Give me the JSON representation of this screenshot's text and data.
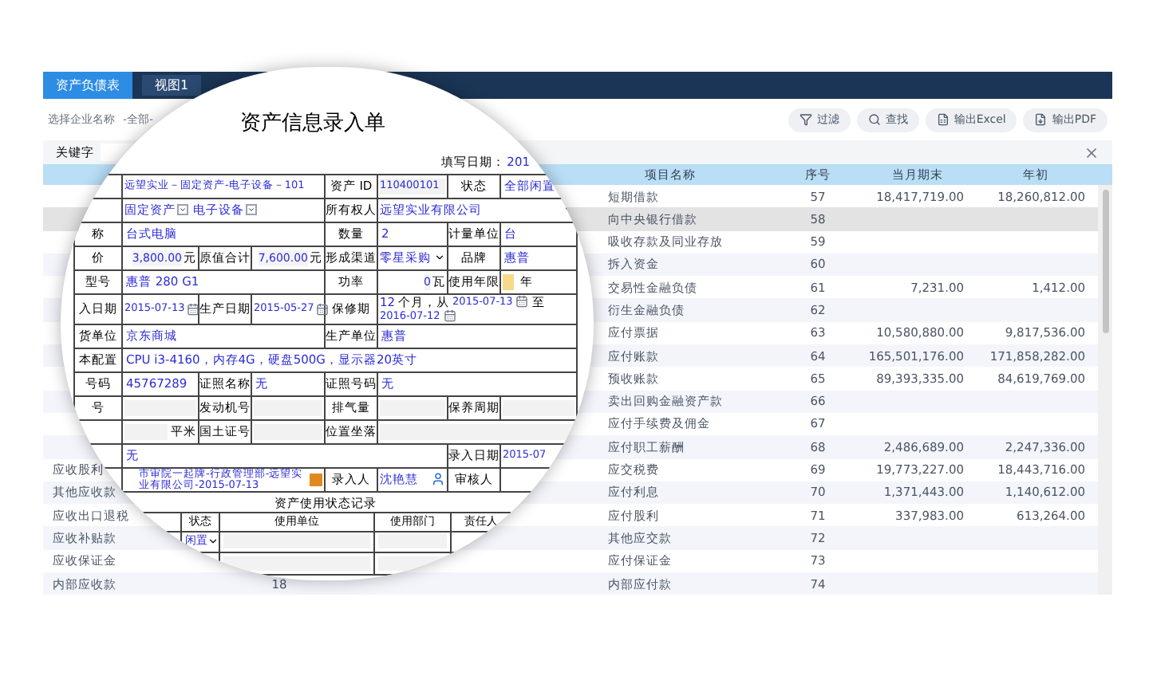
{
  "tabs": [
    {
      "label": "资产负债表",
      "selected": true
    },
    {
      "label": "视图1",
      "selected": false
    }
  ],
  "toolbar": {
    "company_label": "选择企业名称",
    "company_value": "-全部-",
    "buttons": [
      {
        "label": "过滤",
        "kind": "filter"
      },
      {
        "label": "查找",
        "kind": "search"
      },
      {
        "label": "输出Excel",
        "kind": "excel"
      },
      {
        "label": "输出PDF",
        "kind": "pdf"
      }
    ]
  },
  "keyword": {
    "label": "关键字"
  },
  "table": {
    "columns": [
      "项目名称",
      "序号",
      "当月期末",
      "年初"
    ],
    "rows": [
      {
        "name": "短期借款",
        "no": "57",
        "end": "18,417,719.00",
        "start": "18,260,812.00",
        "highlighted": false
      },
      {
        "name": "向中央银行借款",
        "no": "58",
        "highlighted": true
      },
      {
        "name": "吸收存款及同业存放",
        "no": "59",
        "highlighted": false
      },
      {
        "name": "拆入资金",
        "no": "60",
        "highlighted": false
      },
      {
        "name": "交易性金融负债",
        "no": "61",
        "end": "7,231.00",
        "start": "1,412.00",
        "highlighted": false
      },
      {
        "name": "衍生金融负债",
        "no": "62",
        "highlighted": false
      },
      {
        "name": "应付票据",
        "no": "63",
        "end": "10,580,880.00",
        "start": "9,817,536.00",
        "highlighted": false
      },
      {
        "name": "应付账款",
        "no": "64",
        "end": "165,501,176.00",
        "start": "171,858,282.00",
        "highlighted": false
      },
      {
        "name": "预收账款",
        "no": "65",
        "end": "89,393,335.00",
        "start": "84,619,769.00",
        "highlighted": false
      },
      {
        "name": "卖出回购金融资产款",
        "no": "66",
        "highlighted": false
      },
      {
        "name": "应付手续费及佣金",
        "no": "67",
        "highlighted": false
      },
      {
        "name": "应付职工薪酬",
        "no": "68",
        "end": "2,486,689.00",
        "start": "2,247,336.00",
        "highlighted": false
      },
      {
        "name": "应交税费",
        "no": "69",
        "end": "19,773,227.00",
        "start": "18,443,716.00",
        "highlighted": false,
        "left_name": "应收股利"
      },
      {
        "name": "应付利息",
        "no": "70",
        "end": "1,371,443.00",
        "start": "1,140,612.00",
        "highlighted": false,
        "left_name": "其他应收款"
      },
      {
        "name": "应付股利",
        "no": "71",
        "end": "337,983.00",
        "start": "613,264.00",
        "highlighted": false,
        "left_name": "应收出口退税"
      },
      {
        "name": "其他应交款",
        "no": "72",
        "highlighted": false,
        "left_name": "应收补贴款"
      },
      {
        "name": "应付保证金",
        "no": "73",
        "highlighted": false,
        "left_name": "应收保证金"
      },
      {
        "name": "内部应付款",
        "no": "74",
        "highlighted": false,
        "left_name": "内部应收款",
        "left_value": "18"
      }
    ]
  },
  "form": {
    "title": "资产信息录入单",
    "fill_date_label": "填写日期：",
    "fill_date": "201",
    "rows": [
      {
        "cells": [
          {
            "kind": "blank"
          },
          {
            "kind": "small",
            "text": "远望实业－固定资产-电子设备－101"
          },
          "",
          "",
          {
            "kind": "label",
            "text": "资产 ID"
          },
          {
            "kind": "shaded",
            "text": "110400101"
          },
          {
            "kind": "label",
            "text": "状态"
          },
          {
            "kind": "text",
            "text": "全部闲置"
          }
        ]
      },
      {
        "cells": [
          {
            "kind": "blank"
          },
          {
            "kind": "selects",
            "options": [
              "固定资产",
              "电子设备"
            ]
          },
          "",
          "",
          {
            "kind": "label",
            "text": "所有权人"
          },
          {
            "kind": "select",
            "text": "远望实业有限公司"
          },
          "",
          ""
        ]
      },
      {
        "cells": [
          {
            "kind": "label",
            "text": "称"
          },
          {
            "kind": "text",
            "text": "台式电脑"
          },
          "",
          "",
          {
            "kind": "label",
            "text": "数量"
          },
          {
            "kind": "text",
            "text": "2"
          },
          {
            "kind": "label",
            "text": "计量单位"
          },
          {
            "kind": "text",
            "text": "台"
          }
        ]
      },
      {
        "cells": [
          {
            "kind": "label",
            "text": "价"
          },
          {
            "kind": "amount",
            "text": "3,800.00",
            "unit": "元"
          },
          {
            "kind": "label",
            "text": "原值合计"
          },
          {
            "kind": "amount",
            "text": "7,600.00",
            "unit": "元"
          },
          {
            "kind": "label",
            "text": "形成渠道"
          },
          {
            "kind": "select",
            "text": "零星采购"
          },
          {
            "kind": "label",
            "text": "品牌"
          },
          {
            "kind": "text",
            "text": "惠普"
          }
        ]
      },
      {
        "cells": [
          {
            "kind": "label",
            "text": "型号"
          },
          {
            "kind": "text",
            "text": "惠普 280 G1"
          },
          "",
          "",
          {
            "kind": "label",
            "text": "功率"
          },
          {
            "kind": "amount",
            "text": "0",
            "unit": "瓦"
          },
          {
            "kind": "label",
            "text": "使用年限"
          },
          {
            "kind": "years",
            "unit": "年"
          }
        ]
      },
      {
        "cells": [
          {
            "kind": "label",
            "text": "入日期"
          },
          {
            "kind": "date",
            "text": "2015-07-13"
          },
          {
            "kind": "label",
            "text": "生产日期"
          },
          {
            "kind": "date",
            "text": "2015-05-27"
          },
          {
            "kind": "label",
            "text": "保修期"
          },
          {
            "kind": "warranty",
            "months": "12",
            "from_label": "个月，从",
            "from": "2015-07-13",
            "to_label": "至",
            "to": "2016-07-12"
          },
          "",
          ""
        ]
      },
      {
        "cells": [
          {
            "kind": "label",
            "text": "货单位"
          },
          {
            "kind": "text",
            "text": "京东商城"
          },
          "",
          "",
          {
            "kind": "label",
            "text": "生产单位"
          },
          {
            "kind": "text",
            "text": "惠普"
          },
          "",
          ""
        ]
      },
      {
        "cells": [
          {
            "kind": "label",
            "text": "本配置"
          },
          {
            "kind": "text",
            "text": "CPU i3-4160，内存4G，硬盘500G，显示器20英寸"
          },
          "",
          "",
          "",
          "",
          "",
          ""
        ]
      },
      {
        "cells": [
          {
            "kind": "label",
            "text": "号码"
          },
          {
            "kind": "text",
            "text": "45767289"
          },
          {
            "kind": "label",
            "text": "证照名称"
          },
          {
            "kind": "text",
            "text": "无"
          },
          {
            "kind": "label",
            "text": "证照号码"
          },
          {
            "kind": "text",
            "text": "无"
          },
          "",
          ""
        ]
      },
      {
        "cells": [
          {
            "kind": "label",
            "text": "号"
          },
          {
            "kind": "field"
          },
          {
            "kind": "label",
            "text": "发动机号"
          },
          {
            "kind": "field"
          },
          {
            "kind": "label",
            "text": "排气量"
          },
          {
            "kind": "field"
          },
          {
            "kind": "label",
            "text": "保养周期"
          },
          {
            "kind": "field"
          }
        ]
      },
      {
        "cells": [
          {
            "kind": "blank"
          },
          {
            "kind": "field",
            "unit": "平米"
          },
          {
            "kind": "label",
            "text": "国土证号"
          },
          {
            "kind": "field"
          },
          {
            "kind": "label",
            "text": "位置坐落"
          },
          {
            "kind": "field"
          },
          "",
          ""
        ]
      },
      {
        "cells": [
          {
            "kind": "blank"
          },
          {
            "kind": "text",
            "text": "无"
          },
          "",
          "",
          "",
          "",
          {
            "kind": "label",
            "text": "录入日期"
          },
          {
            "kind": "small",
            "text": "2015-07"
          }
        ]
      },
      {
        "cells": [
          {
            "kind": "blank"
          },
          {
            "kind": "org",
            "text": "市审院一起牌-行政管理部-远望实业有限公司-2015-07-13"
          },
          "",
          "",
          {
            "kind": "label",
            "text": "录入人"
          },
          {
            "kind": "person",
            "text": "沈艳慧"
          },
          {
            "kind": "label",
            "text": "审核人"
          },
          {
            "kind": "blank"
          }
        ]
      }
    ],
    "usage": {
      "title": "资产使用状态记录",
      "columns": [
        "状态",
        "使用单位",
        "使用部门",
        "责任人"
      ],
      "rows": [
        {
          "kind": "select",
          "status": "闲置"
        },
        {
          "kind": "blank"
        }
      ]
    }
  }
}
